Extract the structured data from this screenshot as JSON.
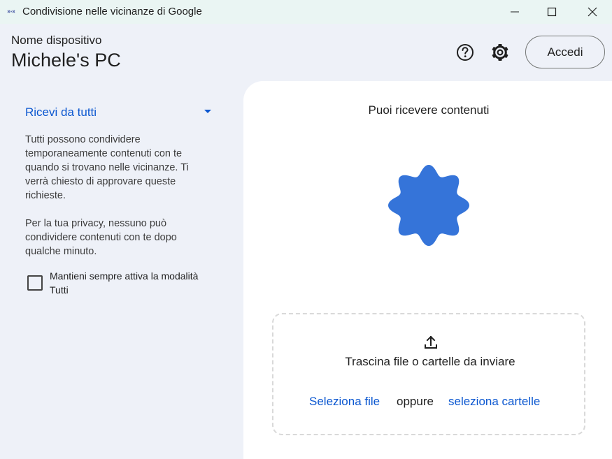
{
  "window": {
    "title": "Condivisione nelle vicinanze di Google"
  },
  "header": {
    "device_label": "Nome dispositivo",
    "device_name": "Michele's PC",
    "signin_label": "Accedi"
  },
  "sidebar": {
    "visibility_selected": "Ricevi da tutti",
    "description_1": "Tutti possono condividere temporaneamente contenuti con te quando si trovano nelle vicinanze. Ti verrà chiesto di approvare queste richieste.",
    "description_2": "Per la tua privacy, nessuno può condividere contenuti con te dopo qualche minuto.",
    "keep_all_mode_label": "Mantieni sempre attiva la modalità Tutti",
    "keep_all_mode_checked": false
  },
  "main": {
    "status_title": "Puoi ricevere contenuti",
    "drop_text": "Trascina file o cartelle da inviare",
    "select_file_label": "Seleziona file",
    "or_label": "oppure",
    "select_folder_label": "seleziona cartelle"
  },
  "colors": {
    "accent": "#0b57d0",
    "status_shape": "#3574d9",
    "titlebar_bg": "#eaf5f3",
    "panel_bg": "#ffffff"
  },
  "icons": {
    "app": "nearby-share-icon",
    "help": "help-icon",
    "settings": "gear-icon",
    "upload": "upload-icon",
    "minimize": "minimize-icon",
    "maximize": "maximize-icon",
    "close": "close-icon"
  }
}
